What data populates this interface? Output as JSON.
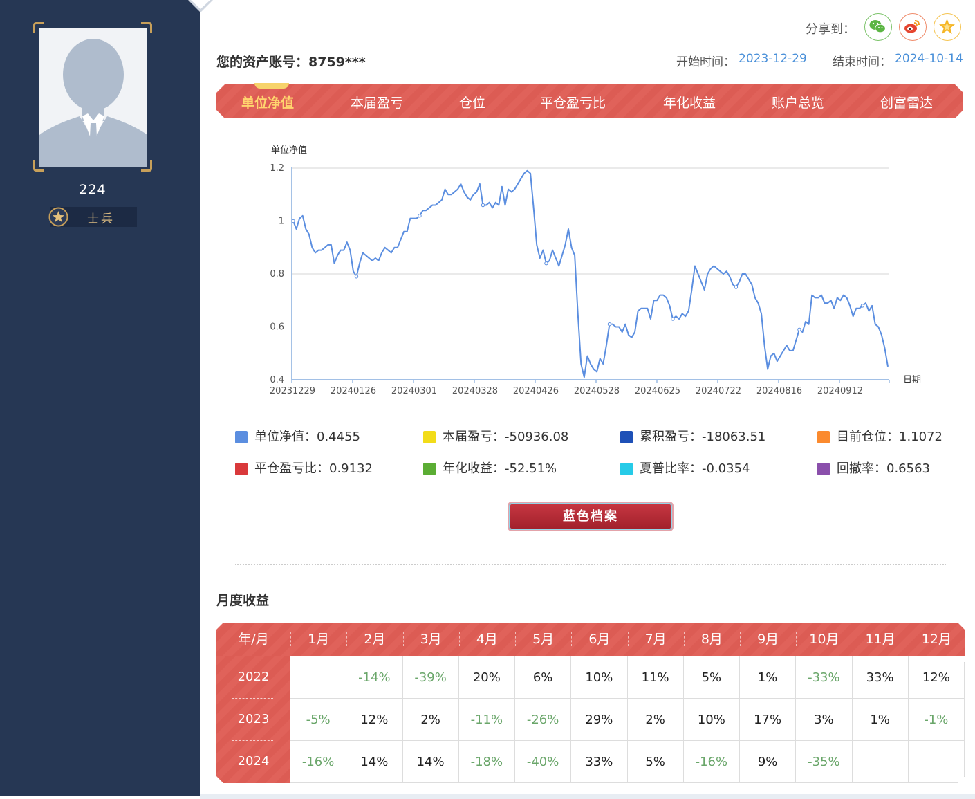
{
  "sidebar": {
    "user_name": "224",
    "rank": "士兵"
  },
  "header": {
    "share_label": "分享到：",
    "share_targets": [
      "wechat-icon",
      "weibo-icon",
      "favorite-star-icon"
    ],
    "account_label": "您的资产账号：8759***",
    "start_label": "开始时间：",
    "start_date": "2023-12-29",
    "end_label": "结束时间：",
    "end_date": "2024-10-14"
  },
  "tabs": [
    {
      "label": "单位净值",
      "active": true
    },
    {
      "label": "本届盈亏",
      "active": false
    },
    {
      "label": "仓位",
      "active": false
    },
    {
      "label": "平仓盈亏比",
      "active": false
    },
    {
      "label": "年化收益",
      "active": false
    },
    {
      "label": "账户总览",
      "active": false
    },
    {
      "label": "创富雷达",
      "active": false
    }
  ],
  "chart_data": {
    "type": "line",
    "ylabel": "单位净值",
    "xlabel": "日期",
    "ylim": [
      0.4,
      1.2
    ],
    "yticks": [
      "1.2",
      "1",
      "0.8",
      "0.6",
      "0.4"
    ],
    "xticks": [
      "20231229",
      "20240126",
      "20240301",
      "20240328",
      "20240426",
      "20240528",
      "20240625",
      "20240722",
      "20240816",
      "20240912"
    ],
    "grid": true,
    "series": [
      {
        "name": "单位净值",
        "color": "#5b8ee0",
        "values": [
          1.0,
          0.97,
          1.01,
          1.02,
          0.97,
          0.95,
          0.9,
          0.88,
          0.89,
          0.89,
          0.9,
          0.91,
          0.91,
          0.84,
          0.87,
          0.89,
          0.89,
          0.92,
          0.89,
          0.81,
          0.79,
          0.84,
          0.88,
          0.87,
          0.86,
          0.85,
          0.86,
          0.85,
          0.88,
          0.9,
          0.89,
          0.88,
          0.9,
          0.9,
          0.93,
          0.96,
          0.96,
          1.01,
          1.01,
          1.01,
          1.02,
          1.04,
          1.04,
          1.05,
          1.06,
          1.06,
          1.07,
          1.08,
          1.12,
          1.1,
          1.1,
          1.11,
          1.12,
          1.14,
          1.11,
          1.09,
          1.08,
          1.1,
          1.11,
          1.14,
          1.06,
          1.06,
          1.07,
          1.05,
          1.07,
          1.06,
          1.13,
          1.06,
          1.12,
          1.11,
          1.12,
          1.14,
          1.16,
          1.18,
          1.19,
          1.18,
          1.05,
          0.91,
          0.86,
          0.89,
          0.84,
          0.85,
          0.89,
          0.86,
          0.83,
          0.87,
          0.91,
          0.97,
          0.9,
          0.87,
          0.65,
          0.46,
          0.41,
          0.49,
          0.46,
          0.44,
          0.43,
          0.48,
          0.46,
          0.53,
          0.61,
          0.61,
          0.6,
          0.6,
          0.58,
          0.61,
          0.57,
          0.56,
          0.58,
          0.66,
          0.67,
          0.67,
          0.67,
          0.63,
          0.7,
          0.7,
          0.72,
          0.72,
          0.71,
          0.68,
          0.63,
          0.64,
          0.63,
          0.65,
          0.64,
          0.66,
          0.74,
          0.83,
          0.8,
          0.77,
          0.74,
          0.8,
          0.82,
          0.83,
          0.82,
          0.81,
          0.8,
          0.81,
          0.79,
          0.76,
          0.75,
          0.77,
          0.8,
          0.8,
          0.78,
          0.76,
          0.71,
          0.69,
          0.65,
          0.53,
          0.44,
          0.49,
          0.5,
          0.47,
          0.49,
          0.51,
          0.53,
          0.51,
          0.51,
          0.55,
          0.59,
          0.58,
          0.62,
          0.61,
          0.72,
          0.71,
          0.71,
          0.72,
          0.69,
          0.69,
          0.7,
          0.67,
          0.71,
          0.7,
          0.72,
          0.71,
          0.68,
          0.64,
          0.67,
          0.67,
          0.68,
          0.69,
          0.66,
          0.68,
          0.61,
          0.6,
          0.57,
          0.52,
          0.45
        ]
      }
    ]
  },
  "stats": [
    {
      "label": "单位净值：0.4455",
      "color": "#5b8ee0"
    },
    {
      "label": "本届盈亏：-50936.08",
      "color": "#f2dc19"
    },
    {
      "label": "累积盈亏：-18063.51",
      "color": "#1e50b7"
    },
    {
      "label": "目前仓位：1.1072",
      "color": "#fb8a2e"
    },
    {
      "label": "平仓盈亏比：0.9132",
      "color": "#d9393b"
    },
    {
      "label": "年化收益：-52.51%",
      "color": "#5bad34"
    },
    {
      "label": "夏普比率：-0.0354",
      "color": "#26cbe8"
    },
    {
      "label": "回撤率：0.6563",
      "color": "#8a4fab"
    }
  ],
  "archive_button": "蓝色档案",
  "monthly": {
    "title": "月度收益",
    "header": [
      "年/月",
      "1月",
      "2月",
      "3月",
      "4月",
      "5月",
      "6月",
      "7月",
      "8月",
      "9月",
      "10月",
      "11月",
      "12月"
    ],
    "rows": [
      {
        "year": "2022",
        "values": [
          "",
          "-14%",
          "-39%",
          "20%",
          "6%",
          "10%",
          "11%",
          "5%",
          "1%",
          "-33%",
          "33%",
          "12%"
        ]
      },
      {
        "year": "2023",
        "values": [
          "-5%",
          "12%",
          "2%",
          "-11%",
          "-26%",
          "29%",
          "2%",
          "10%",
          "17%",
          "3%",
          "1%",
          "-1%"
        ]
      },
      {
        "year": "2024",
        "values": [
          "-16%",
          "14%",
          "14%",
          "-18%",
          "-40%",
          "33%",
          "5%",
          "-16%",
          "9%",
          "-35%",
          "",
          ""
        ]
      }
    ]
  }
}
